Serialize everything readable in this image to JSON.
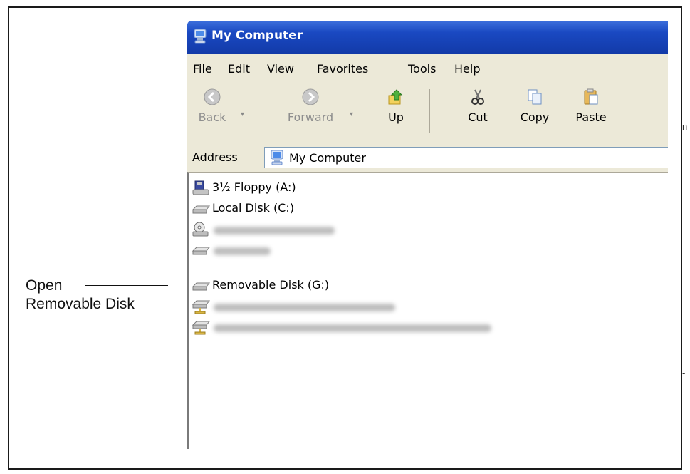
{
  "stray_marks": [
    "n",
    "-"
  ],
  "callout": {
    "line1": "Open",
    "line2": "Removable Disk"
  },
  "window": {
    "title": "My Computer",
    "title_icon": "my-computer-icon",
    "menu": [
      "File",
      "Edit",
      "View",
      "Favorites",
      "Tools",
      "Help"
    ],
    "toolbar": {
      "back": "Back",
      "forward": "Forward",
      "up": "Up",
      "cut": "Cut",
      "copy": "Copy",
      "paste": "Paste"
    },
    "address": {
      "label": "Address",
      "value": "My Computer"
    },
    "drives": [
      {
        "label": "3½ Floppy (A:)",
        "icon": "floppy-drive-icon"
      },
      {
        "label": "Local Disk (C:)",
        "icon": "hard-disk-icon"
      },
      {
        "label": "",
        "icon": "cd-drive-icon",
        "obscured": true
      },
      {
        "label": "",
        "icon": "hard-disk-icon",
        "obscured": true
      },
      {
        "label": "Removable Disk (G:)",
        "icon": "removable-disk-icon"
      },
      {
        "label": "",
        "icon": "network-drive-icon",
        "obscured": true
      },
      {
        "label": "",
        "icon": "network-drive-icon",
        "obscured": true
      }
    ]
  },
  "colors": {
    "titlebar": "#1a49c2",
    "chrome": "#ece9d8",
    "address_border": "#7f9db9"
  }
}
